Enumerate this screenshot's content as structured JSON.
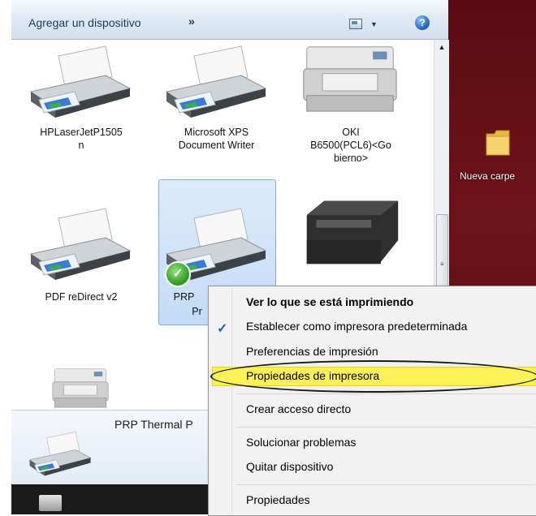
{
  "toolbar": {
    "add_device": "Agregar un dispositivo",
    "more": "»"
  },
  "devices": [
    {
      "name_line1": "HPLaserJetP1505",
      "name_line2": "n"
    },
    {
      "name_line1": "Microsoft XPS",
      "name_line2": "Document Writer"
    },
    {
      "name_line1": "OKI",
      "name_line2": "B6500(PCL6)<Go",
      "name_line3": "bierno>"
    },
    {
      "name_line1": "PDF reDirect v2"
    },
    {
      "name_line1": "PRP",
      "name_line2": "Pr"
    }
  ],
  "details": {
    "title": "PRP Thermal P"
  },
  "desktop": {
    "folder_label": "Nueva carpe"
  },
  "context_menu": {
    "items": [
      {
        "label": "Ver lo que se está imprimiendo",
        "bold": true
      },
      {
        "label": "Establecer como impresora predeterminada",
        "checked": true
      },
      {
        "label": "Preferencias de impresión"
      },
      {
        "label": "Propiedades de impresora",
        "highlighted": true
      },
      {
        "label": "Crear acceso directo"
      },
      {
        "label": "Solucionar problemas"
      },
      {
        "label": "Quitar dispositivo"
      },
      {
        "label": "Propiedades"
      }
    ]
  },
  "colors": {
    "highlight": "#fdf15a",
    "desktop": "#6d1318",
    "selection": "#c3dcf6"
  },
  "icons": [
    "help-icon",
    "view-icon",
    "printer-icon",
    "default-check-icon",
    "folder-icon"
  ]
}
